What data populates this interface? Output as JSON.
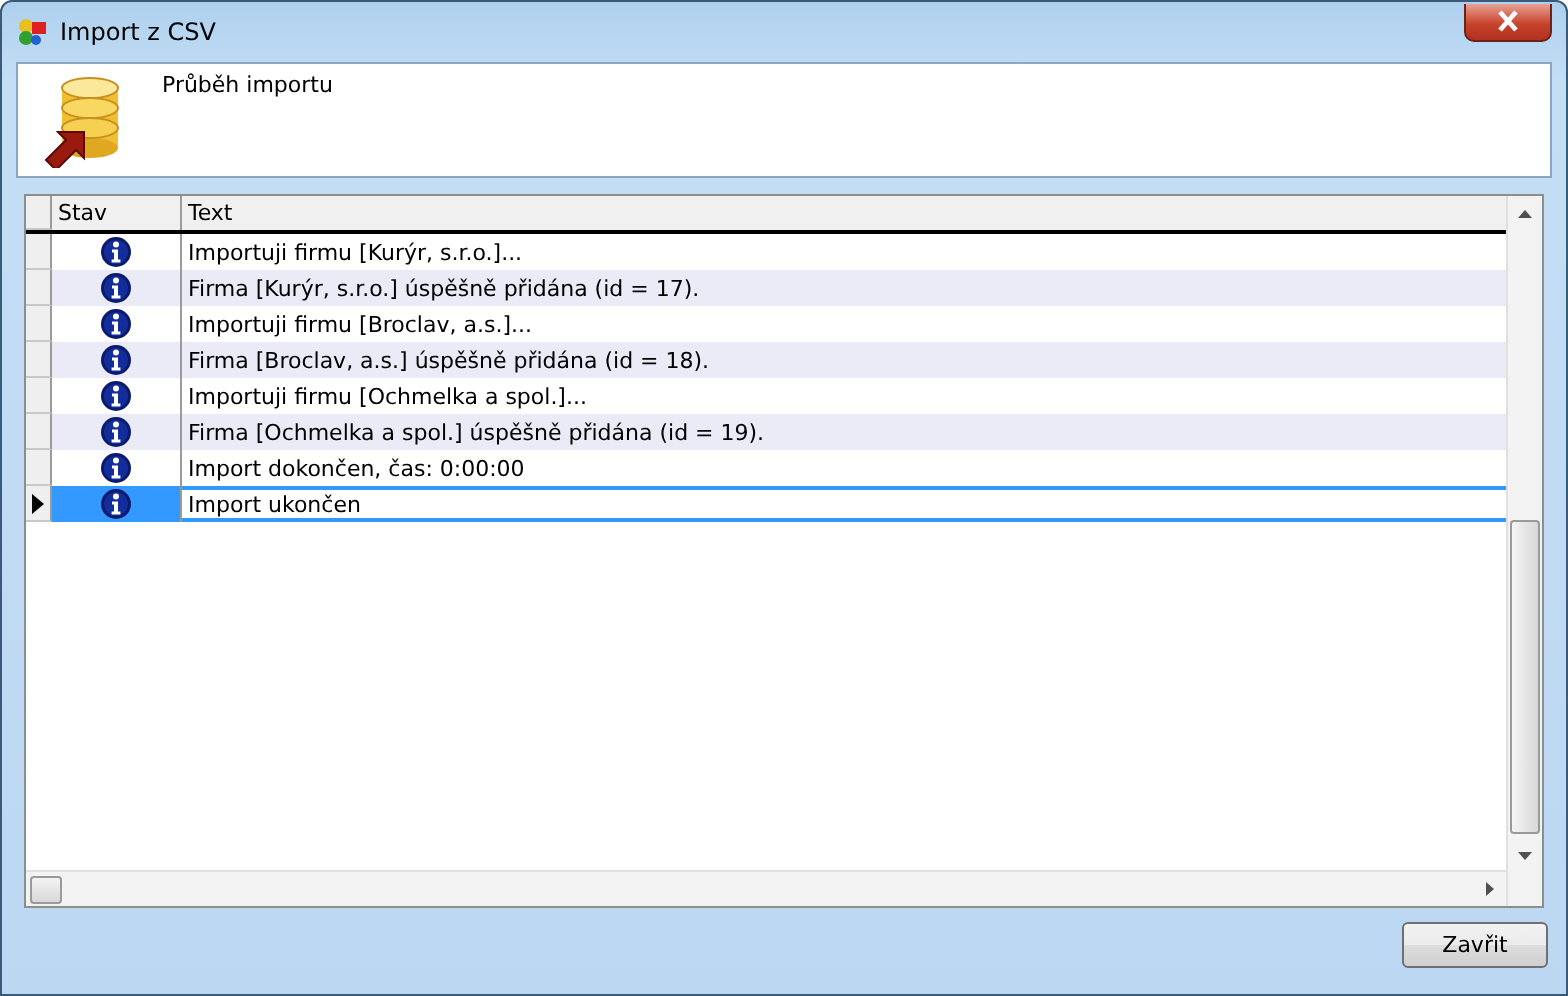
{
  "window": {
    "title": "Import z CSV"
  },
  "header": {
    "title": "Průběh importu"
  },
  "table": {
    "columns": [
      "Stav",
      "Text"
    ],
    "rows": [
      {
        "kind": "info",
        "text": "Importuji firmu [Kurýr, s.r.o.]...",
        "selected": false
      },
      {
        "kind": "info",
        "text": "Firma [Kurýr, s.r.o.] úspěšně přidána (id = 17).",
        "selected": false
      },
      {
        "kind": "info",
        "text": "Importuji firmu [Broclav, a.s.]...",
        "selected": false
      },
      {
        "kind": "info",
        "text": "Firma [Broclav, a.s.] úspěšně přidána (id = 18).",
        "selected": false
      },
      {
        "kind": "info",
        "text": "Importuji firmu [Ochmelka a spol.]...",
        "selected": false
      },
      {
        "kind": "info",
        "text": "Firma [Ochmelka a spol.] úspěšně přidána (id = 19).",
        "selected": false
      },
      {
        "kind": "info",
        "text": "Import dokončen, čas: 0:00:00",
        "selected": false
      },
      {
        "kind": "info",
        "text": "Import ukončen",
        "selected": true
      }
    ]
  },
  "buttons": [
    "Zavřit"
  ]
}
